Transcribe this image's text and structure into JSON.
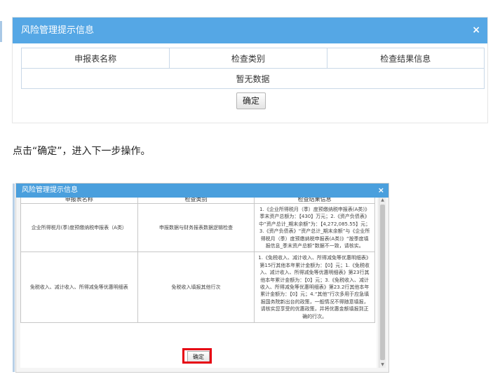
{
  "dialog1": {
    "title": "风险管理提示信息",
    "close_symbol": "×",
    "columns": [
      "申报表名称",
      "检查类别",
      "检查结果信息"
    ],
    "empty_text": "暂无数据",
    "confirm_label": "确定"
  },
  "instruction": "点击“确定”，进入下一步操作。",
  "dialog2": {
    "title": "风险管理提示信息",
    "close_symbol": "×",
    "columns": [
      "申报表名称",
      "检查类别",
      "检查结果信息"
    ],
    "rows": [
      {
        "form": "企业所得税月(季)度预缴纳税申报表（A类）",
        "category": "申报数据与财务报表数据逻辑检查",
        "result": "1.《企业所得税月（季）度预缴纳税申报表(A类)》季末资产总额为：【430】万元；2.《资产负债表》中“资产总计_期末余额”为：【4,272,085.55】元；3.《资产负债表》“资产总计_期末余额”与《企业所得税月（季）度预缴纳税申报表(A类)》“按季度填报信息_季末资产总额”数据不一致，请核实。"
      },
      {
        "form": "免税收入、减计收入、所得减免等优惠明细表",
        "category": "免税收入填报其他行次",
        "result": "1.《免税收入、减计收入、所得减免等优惠明细表》第15行其他本年累计金额为：【0】元；1.《免税收入、减计收入、所得减免等优惠明细表》第23行其他本年累计金额为：【0】元；3.《免税收入、减计收入、所得减免等优惠明细表》第23.2行其他本年累计金额为：【0】元；4.“其他”行次多用于应急填报国务院新出台的政策，一般情况不得随意填报，请核实您享受的优惠政策，并将优惠金额填报到正确的行次。"
      }
    ],
    "confirm_label": "确定"
  },
  "colors": {
    "titlebar_top": "#55a7e5",
    "titlebar_bottom": "#4a9fdd",
    "highlight": "#e60012"
  }
}
